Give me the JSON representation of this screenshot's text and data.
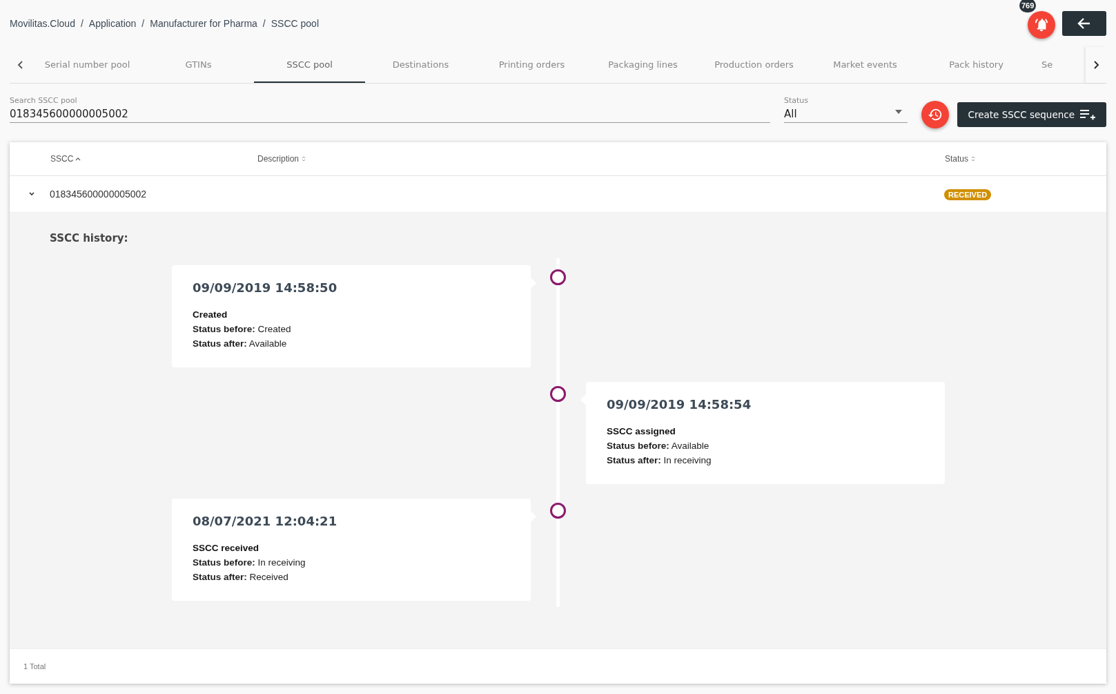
{
  "breadcrumb": [
    "Movilitas.Cloud",
    "Application",
    "Manufacturer for Pharma",
    "SSCC pool"
  ],
  "breadcrumb_separator": "/",
  "notifications": {
    "count": "769"
  },
  "tabs": [
    {
      "label": "Serial number pool",
      "selected": false
    },
    {
      "label": "GTINs",
      "selected": false
    },
    {
      "label": "SSCC pool",
      "selected": true
    },
    {
      "label": "Destinations",
      "selected": false
    },
    {
      "label": "Printing orders",
      "selected": false
    },
    {
      "label": "Packaging lines",
      "selected": false
    },
    {
      "label": "Production orders",
      "selected": false
    },
    {
      "label": "Market events",
      "selected": false
    },
    {
      "label": "Pack history",
      "selected": false
    },
    {
      "label": "Se",
      "selected": false
    }
  ],
  "search": {
    "label": "Search SSCC pool",
    "value": "018345600000005002"
  },
  "status_filter": {
    "label": "Status",
    "value": "All"
  },
  "create_button": "Create SSCC sequence",
  "table": {
    "columns": [
      {
        "label": "SSCC",
        "sorted": true
      },
      {
        "label": "Description",
        "sorted": false
      },
      {
        "label": "Status",
        "sorted": false
      }
    ],
    "rows": [
      {
        "sscc": "018345600000005002",
        "status": "RECEIVED",
        "expanded": true
      }
    ],
    "history": {
      "title": "SSCC history:",
      "events": [
        {
          "timestamp": "09/09/2019 14:58:50",
          "event": "Created",
          "before": "**Status before:** Created",
          "after": "**Status after:** Available"
        },
        {
          "timestamp": "09/09/2019 14:58:54",
          "event": "SSCC assigned",
          "before": "**Status before:** Available",
          "after": "**Status after:** In receiving"
        },
        {
          "timestamp": "08/07/2021 12:04:21",
          "event": "SSCC received",
          "before": "**Status before:** In receiving",
          "after": "**Status after:** Received"
        }
      ]
    },
    "footer": "1 Total"
  }
}
